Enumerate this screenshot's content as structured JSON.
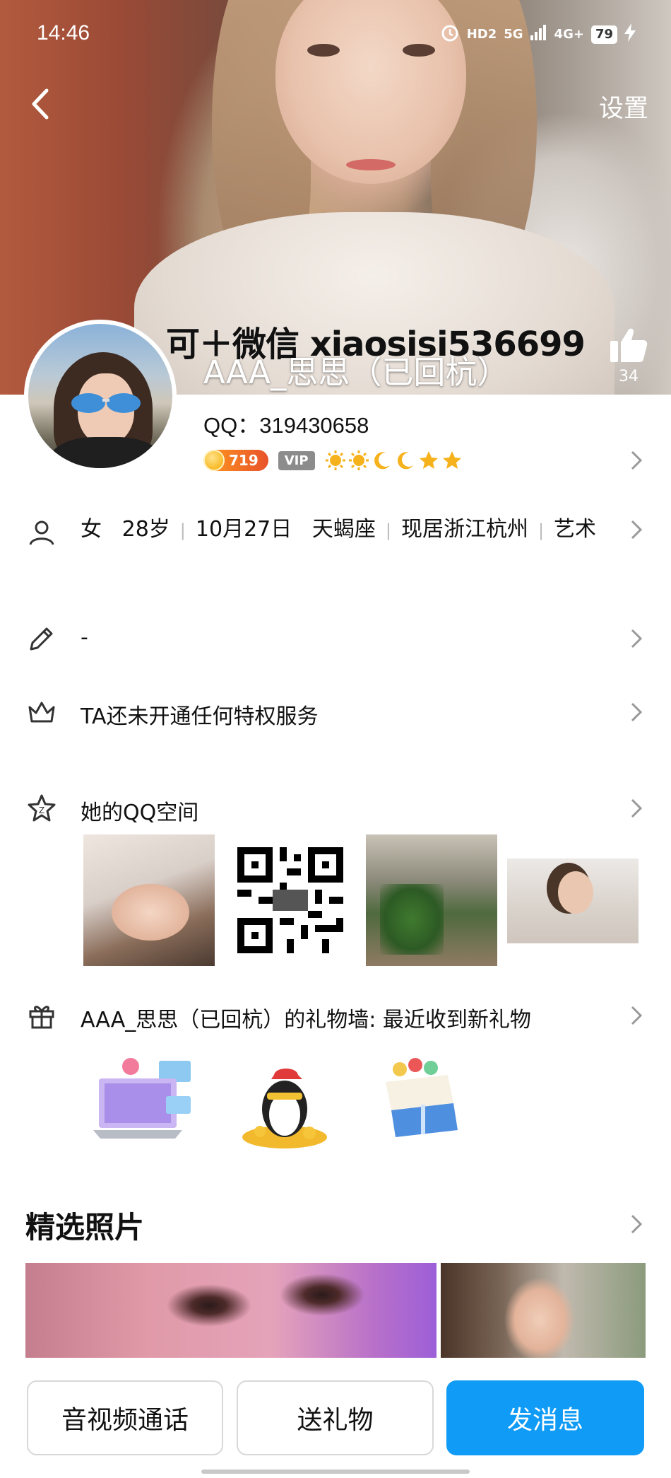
{
  "status_bar": {
    "time": "14:46",
    "network_labels": [
      "HD2",
      "5G",
      "4G+"
    ],
    "battery": "79"
  },
  "header": {
    "settings_label": "设置",
    "watermark": "可＋微信 xiaosisi536699",
    "nickname": "AAA_思思（已回杭）",
    "like_count": "34"
  },
  "profile": {
    "qq": "QQ：319430658",
    "level_badge": "719",
    "vip_badge": "VIP"
  },
  "info_row": {
    "gender": "女",
    "age": "28岁",
    "birthday": "10月27日",
    "zodiac": "天蝎座",
    "location": "现居浙江杭州",
    "occupation": "艺术"
  },
  "signature_row": {
    "text": "-"
  },
  "privilege_row": {
    "text": "TA还未开通任何特权服务"
  },
  "qzone_row": {
    "text": "她的QQ空间"
  },
  "gift_row": {
    "text": "AAA_思思（已回杭）的礼物墙: 最近收到新礼物"
  },
  "featured": {
    "title": "精选照片"
  },
  "bottom_bar": {
    "call_label": "音视频通话",
    "gift_label": "送礼物",
    "message_label": "发消息"
  },
  "colors": {
    "primary": "#0f9bf6",
    "vip_gray": "#8c8c8c",
    "level_orange": "#f08a24"
  }
}
